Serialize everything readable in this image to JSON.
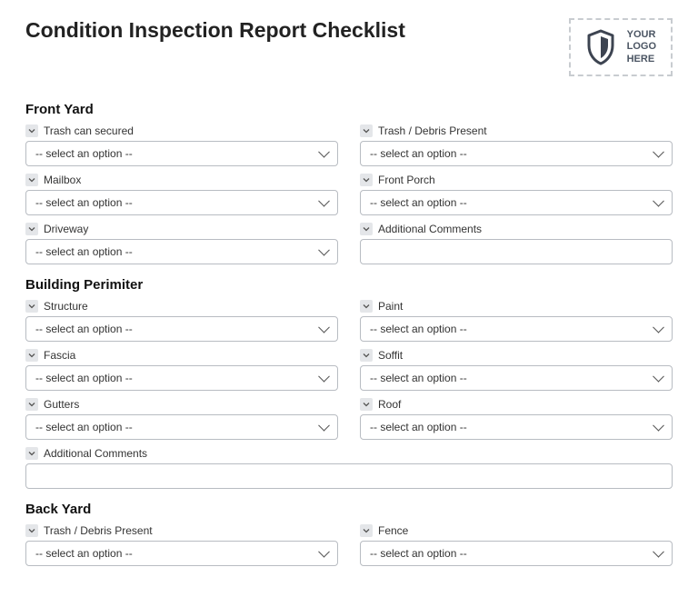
{
  "title": "Condition Inspection Report Checklist",
  "logo": {
    "line1": "YOUR",
    "line2": "LOGO",
    "line3": "HERE"
  },
  "select_placeholder": "-- select an option --",
  "sections": {
    "front_yard": {
      "title": "Front Yard",
      "trash_can_secured": "Trash can secured",
      "trash_debris": "Trash / Debris Present",
      "mailbox": "Mailbox",
      "front_porch": "Front Porch",
      "driveway": "Driveway",
      "additional_comments": "Additional Comments"
    },
    "building_perimeter": {
      "title": "Building Perimiter",
      "structure": "Structure",
      "paint": "Paint",
      "fascia": "Fascia",
      "soffit": "Soffit",
      "gutters": "Gutters",
      "roof": "Roof",
      "additional_comments": "Additional Comments"
    },
    "back_yard": {
      "title": "Back Yard",
      "trash_debris": "Trash / Debris Present",
      "fence": "Fence"
    }
  }
}
